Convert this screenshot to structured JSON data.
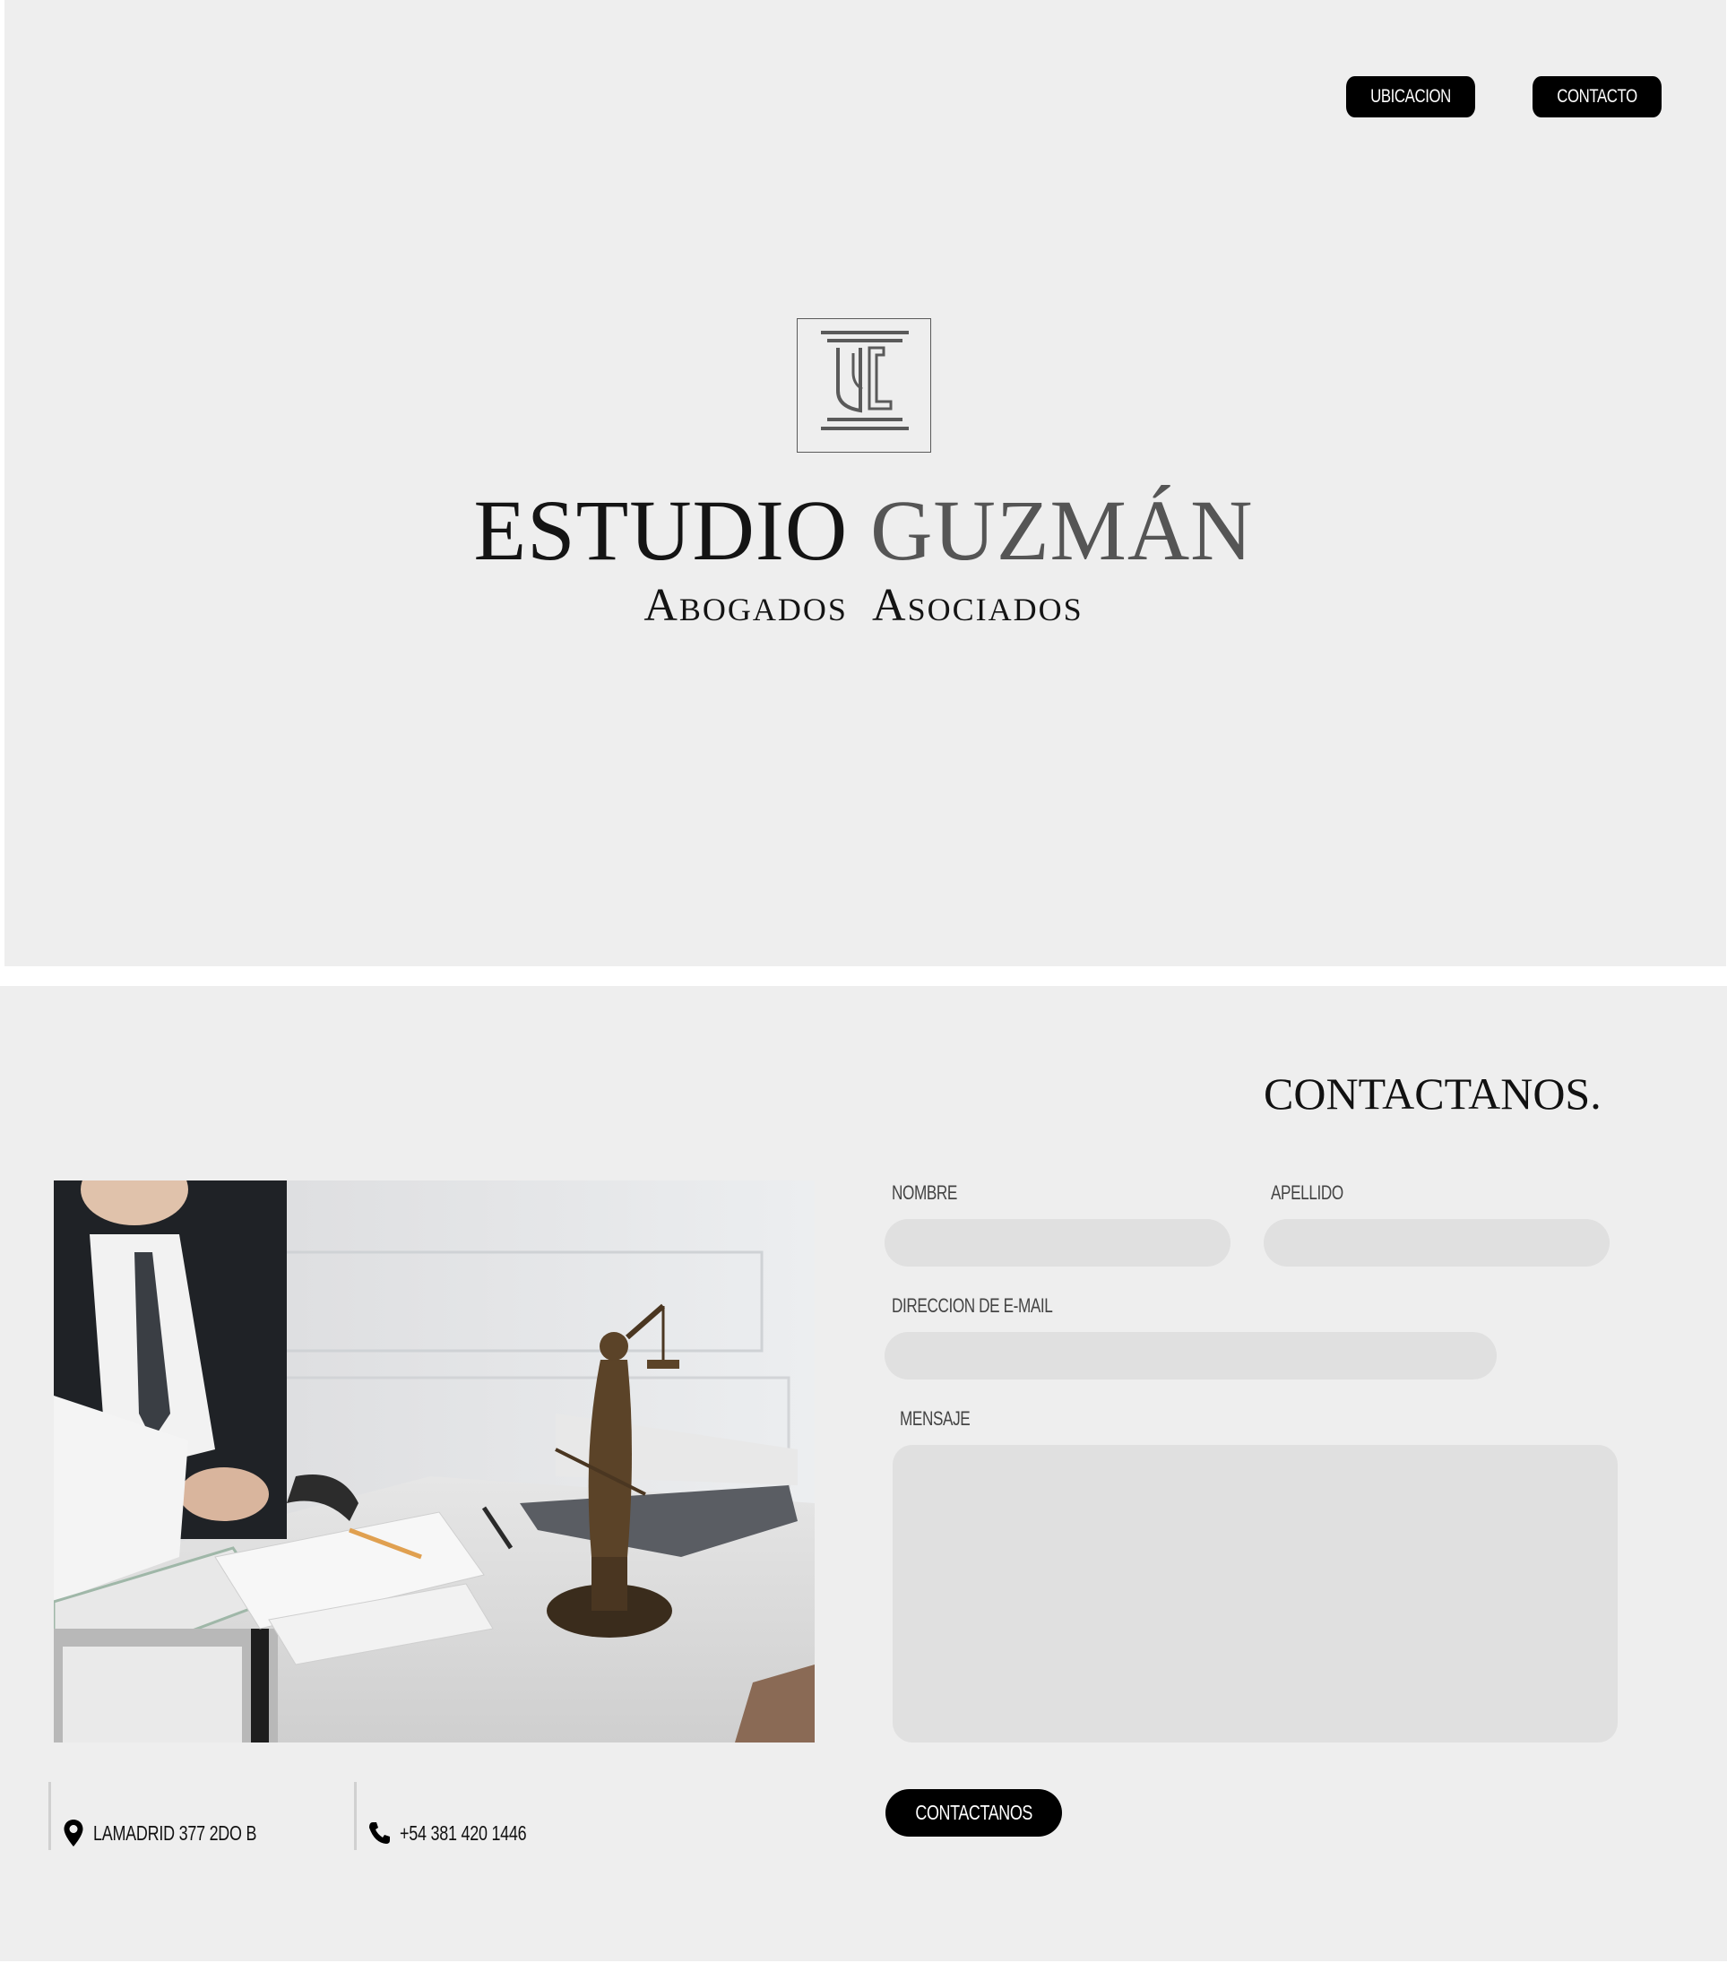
{
  "nav": {
    "ubicacion": "UBICACION",
    "contacto": "CONTACTO"
  },
  "brand": {
    "name_part1": "ESTUDIO",
    "name_part2": "GUZMÁN",
    "tagline": "Abogados  Asociados"
  },
  "contact_section": {
    "title": "CONTACTANOS.",
    "form": {
      "nombre_label": "NOMBRE",
      "nombre_value": "",
      "apellido_label": "APELLIDO",
      "apellido_value": "",
      "email_label": "DIRECCION DE E-MAIL",
      "email_value": "",
      "mensaje_label": "MENSAJE",
      "mensaje_value": "",
      "submit_label": "CONTACTANOS"
    },
    "info": {
      "address": "LAMADRID 377 2DO B",
      "phone": "+54 381 420 1446"
    }
  },
  "icons": {
    "logo": "column-emblem-icon",
    "address": "map-pin-icon",
    "phone": "phone-icon"
  },
  "colors": {
    "background": "#eeeeee",
    "button": "#000000",
    "input": "#e0e0e0",
    "brand_dark": "#141414",
    "brand_gray": "#555555"
  }
}
